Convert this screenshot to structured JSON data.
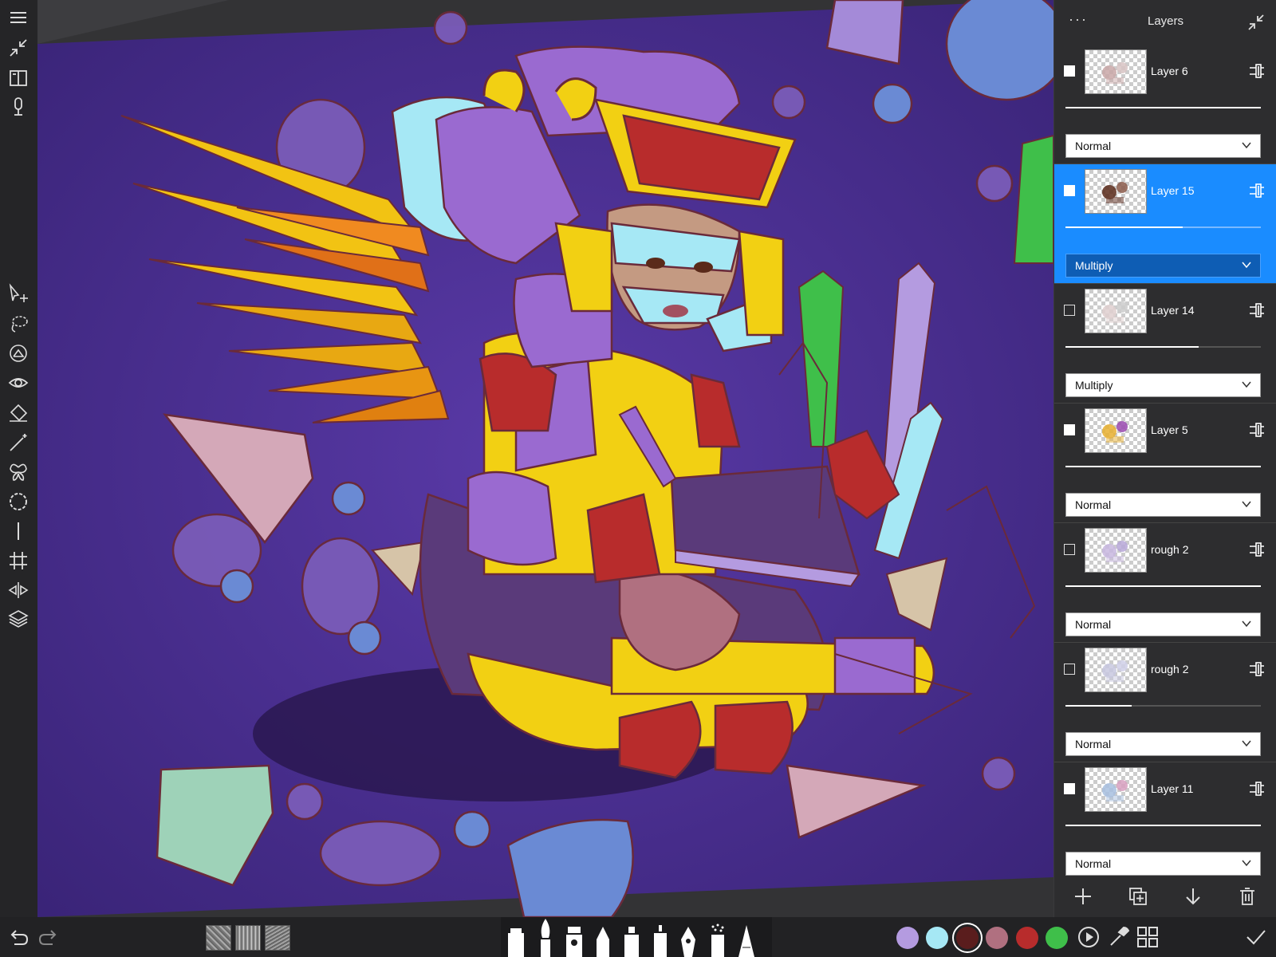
{
  "layers_panel": {
    "title": "Layers",
    "more_label": "···",
    "layers": [
      {
        "name": "Layer 6",
        "visible": true,
        "blend_mode": "Normal",
        "opacity": 1.0,
        "selected": false
      },
      {
        "name": "Layer 15",
        "visible": true,
        "blend_mode": "Multiply",
        "opacity": 0.6,
        "selected": true
      },
      {
        "name": "Layer 14",
        "visible": false,
        "blend_mode": "Multiply",
        "opacity": 0.68,
        "selected": false
      },
      {
        "name": "Layer 5",
        "visible": true,
        "blend_mode": "Normal",
        "opacity": 1.0,
        "selected": false
      },
      {
        "name": "rough 2",
        "visible": false,
        "blend_mode": "Normal",
        "opacity": 1.0,
        "selected": false
      },
      {
        "name": "rough 2",
        "visible": false,
        "blend_mode": "Normal",
        "opacity": 0.34,
        "selected": false
      },
      {
        "name": "Layer 11",
        "visible": true,
        "blend_mode": "Normal",
        "opacity": 1.0,
        "selected": false
      }
    ],
    "footer_icons": [
      "add-layer-icon",
      "duplicate-layer-icon",
      "merge-down-icon",
      "delete-layer-icon"
    ]
  },
  "left_toolbar": {
    "top_icons": [
      "menu-icon",
      "fullscreen-collapse-icon",
      "book-icon",
      "microphone-icon"
    ],
    "tool_icons": [
      "transform-select-icon",
      "lasso-icon",
      "ruler-icon",
      "eye-icon",
      "fill-bucket-icon",
      "magic-wand-icon",
      "symmetry-butterfly-icon",
      "circle-guide-icon",
      "line-guide-icon",
      "perspective-grid-icon",
      "flip-icon",
      "layers-icon"
    ]
  },
  "bottom_toolbar": {
    "history_icons": [
      "undo-icon",
      "redo-icon"
    ],
    "textures": [
      "texture-1",
      "texture-2",
      "texture-3"
    ],
    "brushes": [
      "marker-brush",
      "paintbrush-brush",
      "ink-pen-brush",
      "pencil-brush",
      "highlighter-brush",
      "fineliner-brush",
      "calligraphy-pen-brush",
      "airbrush-brush",
      "pencil-sharp-brush"
    ],
    "color_swatches": [
      {
        "name": "lavender",
        "color": "#b49be0",
        "active": false
      },
      {
        "name": "light-cyan",
        "color": "#a6e8f5",
        "active": false
      },
      {
        "name": "dark-maroon",
        "color": "#5a1d1d",
        "active": true
      },
      {
        "name": "dusty-rose",
        "color": "#b07080",
        "active": false
      },
      {
        "name": "red",
        "color": "#b82c2c",
        "active": false
      },
      {
        "name": "green",
        "color": "#3fbf4a",
        "active": false
      }
    ],
    "right_icons": [
      "playback-icon",
      "eyedropper-icon",
      "grid-view-icon",
      "confirm-check-icon"
    ]
  },
  "colors": {
    "accent": "#1a8cff",
    "canvas_bg": "#4b2f8f"
  }
}
